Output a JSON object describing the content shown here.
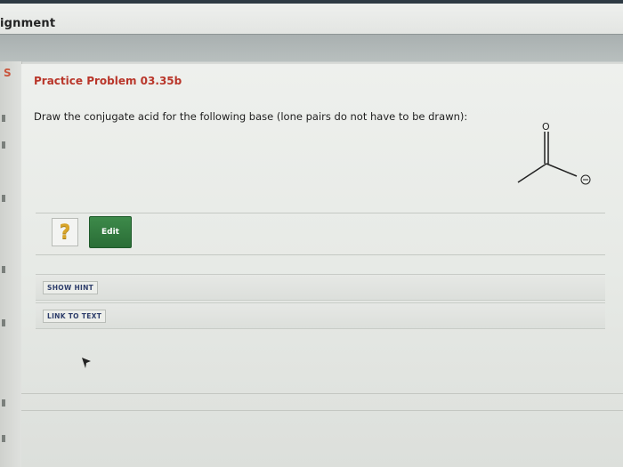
{
  "header": {
    "title": "ignment"
  },
  "sidebar": {
    "marker": "S"
  },
  "problem": {
    "title": "Practice Problem 03.35b",
    "prompt": "Draw the conjugate acid for the following base (lone pairs do not have to be drawn):"
  },
  "molecule": {
    "atom_top": "O",
    "charge": "⊖"
  },
  "answer": {
    "placeholder_symbol": "?",
    "edit_label": "Edit"
  },
  "buttons": {
    "show_hint": "SHOW HINT",
    "link_to_text": "LINK TO TEXT"
  },
  "colors": {
    "title": "#b9362a",
    "edit_button": "#2f7a3d",
    "hint_text": "#2d3d6a"
  }
}
